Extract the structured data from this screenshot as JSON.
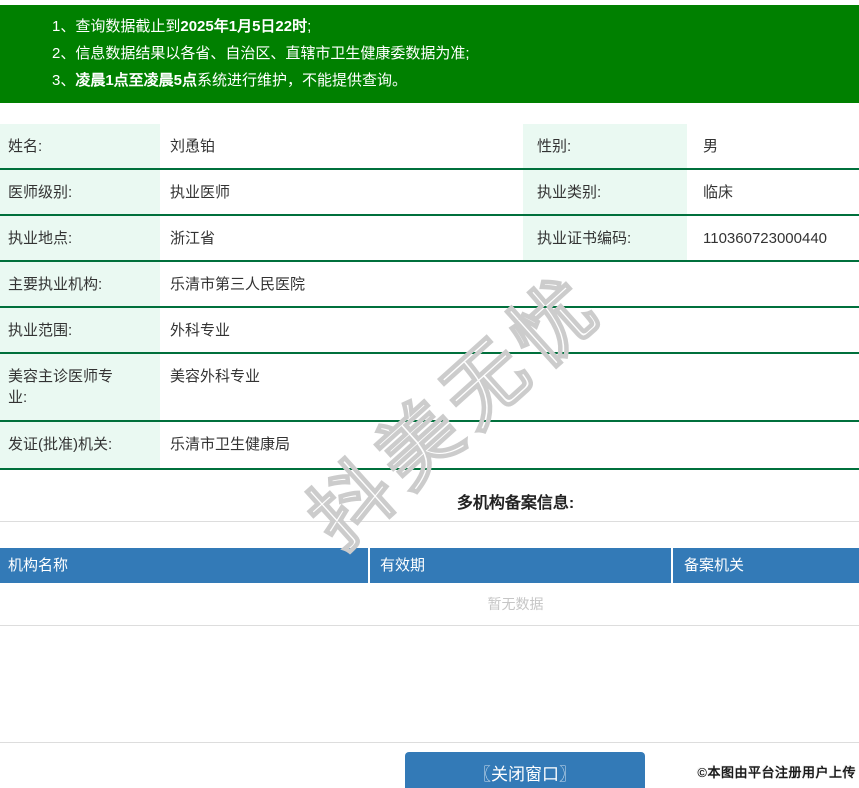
{
  "notice": {
    "lines": [
      {
        "num": "1、",
        "pre": "查询数据截止到",
        "bold": "2025年1月5日22时",
        "post": ";"
      },
      {
        "num": "2、",
        "pre": "信息数据结果以各省、自治区、直辖市卫生健康委数据为准;",
        "bold": "",
        "post": ""
      },
      {
        "num": "3、",
        "pre": "",
        "bold": "凌晨1点至凌晨5点",
        "post": "系统进行维护，不能提供查询。"
      }
    ]
  },
  "profile": {
    "rows": [
      {
        "label": "姓名:",
        "value": "刘恿铂",
        "label2": "性别:",
        "value2": "男"
      },
      {
        "label": "医师级别:",
        "value": "执业医师",
        "label2": "执业类别:",
        "value2": "临床"
      },
      {
        "label": "执业地点:",
        "value": "浙江省",
        "label2": "执业证书编码:",
        "value2": "110360723000440"
      },
      {
        "label": "主要执业机构:",
        "value": "乐清市第三人民医院"
      },
      {
        "label": "执业范围:",
        "value": "外科专业"
      },
      {
        "label": "美容主诊医师专业:",
        "value": "美容外科专业"
      },
      {
        "label": "发证(批准)机关:",
        "value": "乐清市卫生健康局"
      }
    ]
  },
  "filing": {
    "section_title": "多机构备案信息:",
    "headers": [
      "机构名称",
      "有效期",
      "备案机关"
    ],
    "empty_text": "暂无数据"
  },
  "watermark": {
    "text": "抖美无忧"
  },
  "footer": {
    "close_button_label": "〖关闭窗口〗",
    "copyright": "©本图由平台注册用户上传"
  },
  "colors": {
    "notice_green": "#008000",
    "row_border_green": "#00703c",
    "label_cell_bg": "#eaf9f2",
    "table_header_blue": "#337ab7",
    "button_blue": "#337ab7"
  }
}
